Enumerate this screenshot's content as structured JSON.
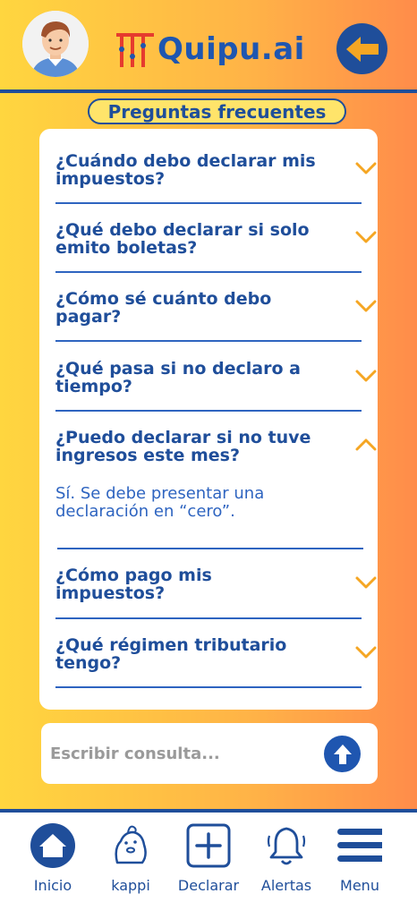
{
  "header": {
    "logo_text": "Quipu.ai",
    "back_label": ""
  },
  "title": "Preguntas frecuentes",
  "faq": [
    {
      "question": "¿Cuándo debo declarar mis impuestos?",
      "expanded": false
    },
    {
      "question": "¿Qué debo declarar si solo emito boletas?",
      "expanded": false
    },
    {
      "question": "¿Cómo sé cuánto debo pagar?",
      "expanded": false
    },
    {
      "question": "¿Qué pasa si no declaro a tiempo?",
      "expanded": false
    },
    {
      "question": "¿Puedo declarar si no tuve ingresos este mes?",
      "expanded": true,
      "answer": "Sí. Se debe presentar una declaración en “cero”."
    },
    {
      "question": "¿Cómo pago mis impuestos?",
      "expanded": false
    },
    {
      "question": "¿Qué régimen tributario tengo?",
      "expanded": false
    }
  ],
  "chat": {
    "placeholder": "Escribir consulta..."
  },
  "nav": [
    {
      "label": "Inicio",
      "icon": "home-icon"
    },
    {
      "label": "kappi",
      "icon": "capybara-icon"
    },
    {
      "label": "Declarar",
      "icon": "plus-square-icon"
    },
    {
      "label": "Alertas",
      "icon": "bell-icon"
    },
    {
      "label": "Menu",
      "icon": "hamburger-icon"
    }
  ],
  "colors": {
    "primary": "#1F4E9A",
    "accent": "#F5A623",
    "gradient_start": "#FFD63F",
    "gradient_end": "#FF8C4A"
  }
}
